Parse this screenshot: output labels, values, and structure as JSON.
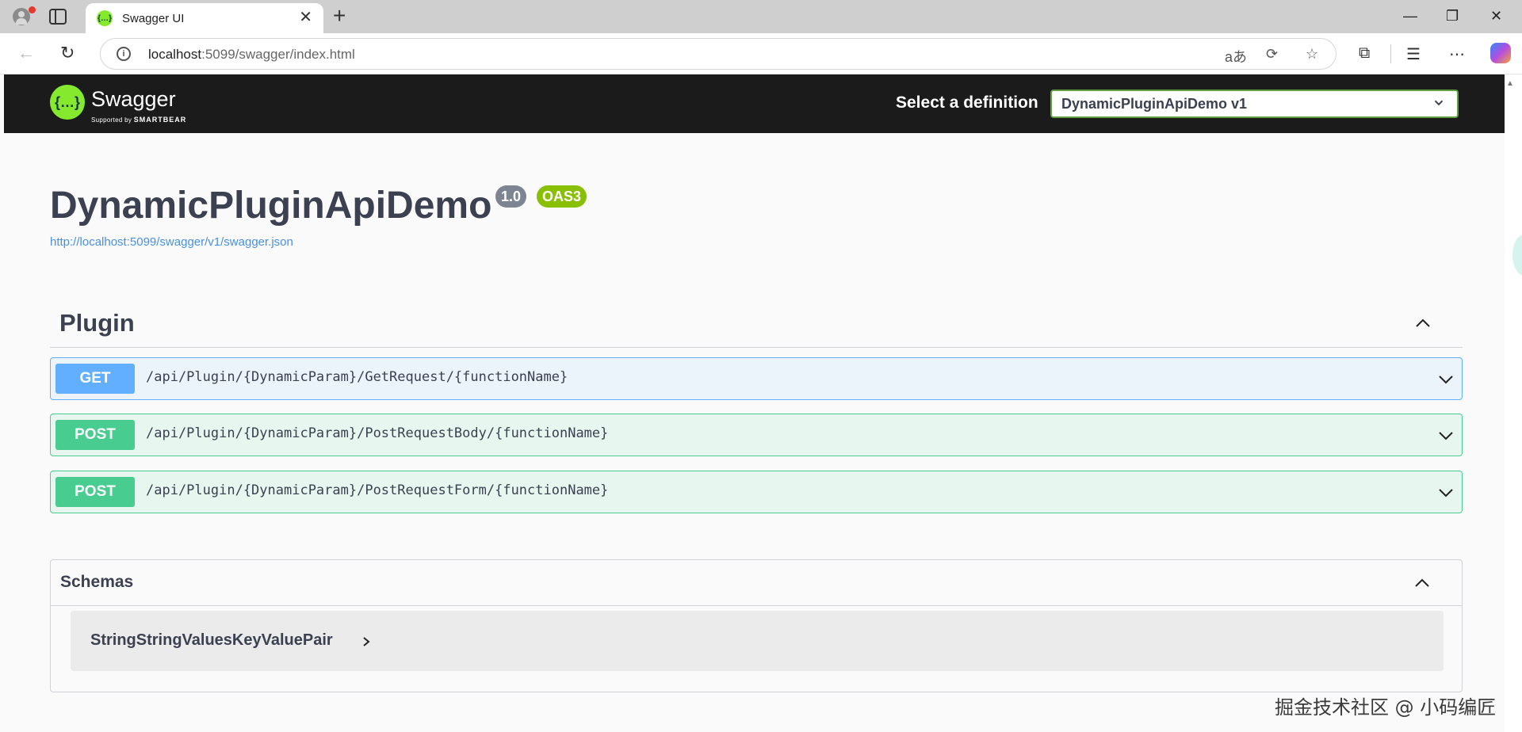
{
  "browser": {
    "tab_title": "Swagger UI",
    "url_host": "localhost",
    "url_rest": ":5099/swagger/index.html"
  },
  "swagger": {
    "logo_text": "Swagger",
    "logo_sub_prefix": "Supported by",
    "logo_sub_brand": "SMARTBEAR",
    "definition_label": "Select a definition",
    "definition_value": "DynamicPluginApiDemo v1",
    "title": "DynamicPluginApiDemo",
    "version": "1.0",
    "oas_badge": "OAS3",
    "spec_url": "http://localhost:5099/swagger/v1/swagger.json"
  },
  "tag": {
    "name": "Plugin",
    "operations": [
      {
        "method": "GET",
        "path": "/api/Plugin/{DynamicParam}/GetRequest/{functionName}"
      },
      {
        "method": "POST",
        "path": "/api/Plugin/{DynamicParam}/PostRequestBody/{functionName}"
      },
      {
        "method": "POST",
        "path": "/api/Plugin/{DynamicParam}/PostRequestForm/{functionName}"
      }
    ]
  },
  "schemas": {
    "title": "Schemas",
    "models": [
      "StringStringValuesKeyValuePair"
    ]
  },
  "watermark": "掘金技术社区 @ 小码编匠",
  "colors": {
    "topbar": "#1b1b1b",
    "swagger_green": "#85ea2d",
    "get": "#61affe",
    "post": "#49cc90",
    "oas3": "#89bf04",
    "version": "#7d8492"
  }
}
